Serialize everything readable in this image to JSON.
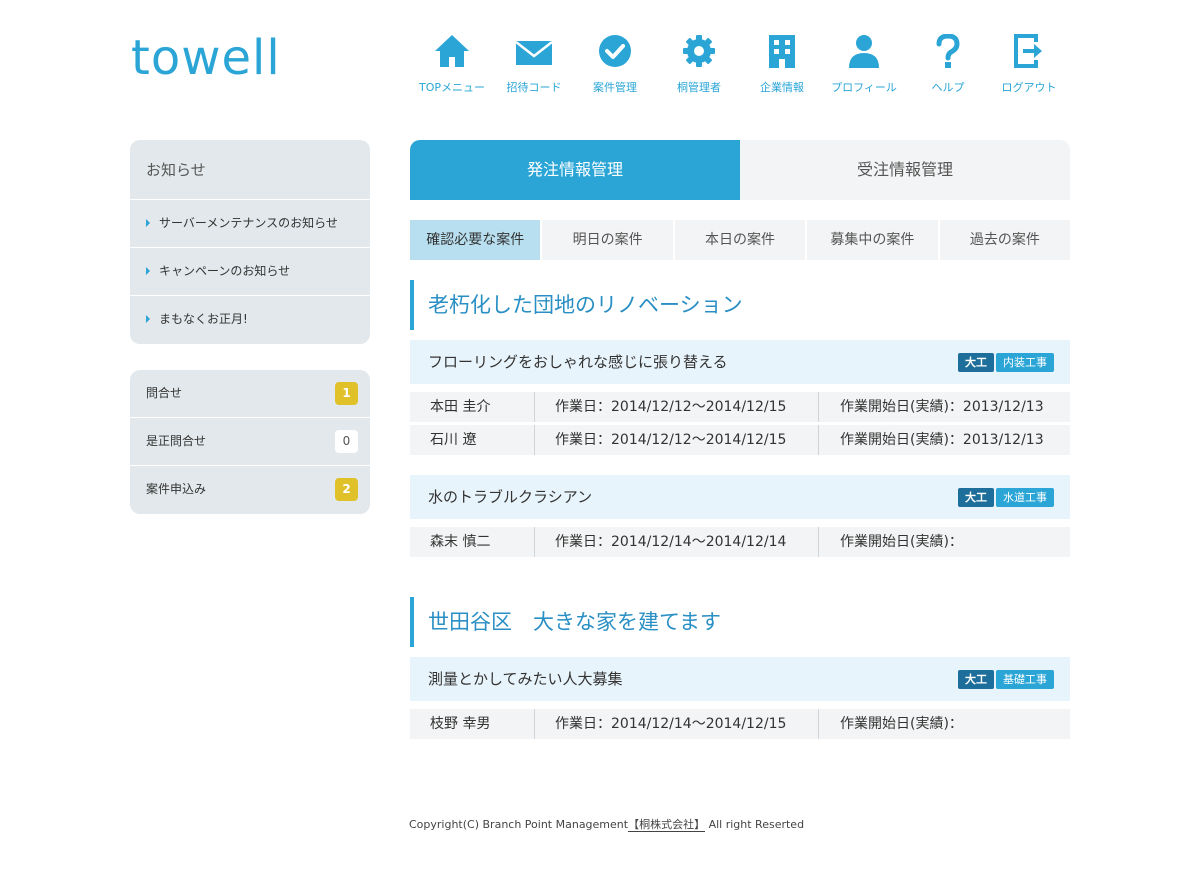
{
  "brand": {
    "logo_text": "towell",
    "accent": "#2aa5d6"
  },
  "nav": [
    {
      "label": "TOPメニュー",
      "icon": "home-icon"
    },
    {
      "label": "招待コード",
      "icon": "mail-icon"
    },
    {
      "label": "案件管理",
      "icon": "check-circle-icon"
    },
    {
      "label": "桐管理者",
      "icon": "gear-icon"
    },
    {
      "label": "企業情報",
      "icon": "building-icon"
    },
    {
      "label": "プロフィール",
      "icon": "user-icon"
    },
    {
      "label": "ヘルプ",
      "icon": "question-icon"
    },
    {
      "label": "ログアウト",
      "icon": "logout-icon"
    }
  ],
  "sidebar": {
    "news_title": "お知らせ",
    "news": [
      "サーバーメンテナンスのお知らせ",
      "キャンペーンのお知らせ",
      "まもなくお正月!"
    ],
    "counters": [
      {
        "label": "問合せ",
        "count": "1",
        "style": "yellow"
      },
      {
        "label": "是正問合せ",
        "count": "0",
        "style": "white"
      },
      {
        "label": "案件申込み",
        "count": "2",
        "style": "yellow"
      }
    ]
  },
  "main": {
    "tabs": [
      "発注情報管理",
      "受注情報管理"
    ],
    "subtabs": [
      "確認必要な案件",
      "明日の案件",
      "本日の案件",
      "募集中の案件",
      "過去の案件"
    ],
    "projects": [
      {
        "title": "老朽化した団地のリノベーション",
        "jobs": [
          {
            "title": "フローリングをおしゃれな感じに張り替える",
            "tags": [
              "大工",
              "内装工事"
            ],
            "workers": [
              {
                "name": "本田 圭介",
                "work_date": "作業日：2014/12/12〜2014/12/15",
                "start": "作業開始日(実績)：2013/12/13"
              },
              {
                "name": "石川 遼",
                "work_date": "作業日：2014/12/12〜2014/12/15",
                "start": "作業開始日(実績)：2013/12/13"
              }
            ]
          },
          {
            "title": "水のトラブルクラシアン",
            "tags": [
              "大工",
              "水道工事"
            ],
            "workers": [
              {
                "name": "森末 慎二",
                "work_date": "作業日：2014/12/14〜2014/12/14",
                "start": "作業開始日(実績)："
              }
            ]
          }
        ]
      },
      {
        "title": "世田谷区　大きな家を建てます",
        "jobs": [
          {
            "title": "測量とかしてみたい人大募集",
            "tags": [
              "大工",
              "基礎工事"
            ],
            "workers": [
              {
                "name": "枝野 幸男",
                "work_date": "作業日：2014/12/14〜2014/12/15",
                "start": "作業開始日(実績)："
              }
            ]
          }
        ]
      }
    ]
  },
  "footer": {
    "prefix": "Copyright(C) Branch Point Management",
    "company": "【桐株式会社】",
    "suffix": " All right Reserted"
  }
}
